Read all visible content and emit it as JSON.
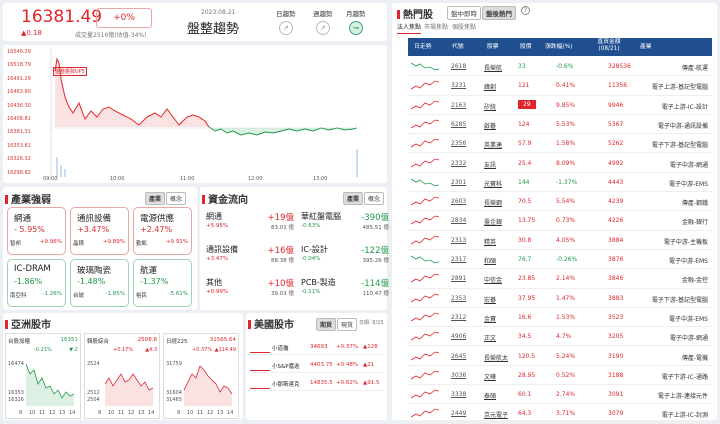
{
  "index": {
    "value": "16381.49",
    "change_pct": "+0%",
    "change": "▲0.18",
    "date": "2023.08.21",
    "volume": "成交量2516億(估值-34%)",
    "title": "盤整趨勢",
    "trend_buttons": [
      {
        "label": "日趨勢"
      },
      {
        "label": "週趨勢"
      },
      {
        "label": "月趨勢"
      }
    ],
    "y_ticks": [
      "16546.29",
      "16518.79",
      "16491.29",
      "16463.80",
      "16436.30",
      "16408.81",
      "16381.31",
      "16353.81",
      "16326.32",
      "16298.82"
    ],
    "x_ticks": [
      "09:00",
      "10:00",
      "11:00",
      "12:00",
      "13:00"
    ],
    "badge": "盤整趨勢UP5"
  },
  "industry": {
    "title": "產業強弱",
    "tabs": [
      "產業",
      "概念"
    ],
    "cards": [
      {
        "name": "網通",
        "pct": "- 5.95%",
        "sub1_label": "智邦",
        "sub1": "+9.96%",
        "color": "red"
      },
      {
        "name": "通訊設備",
        "pct": "+3.47%",
        "sub1_label": "晶鎂",
        "sub1": "+9.89%",
        "color": "red"
      },
      {
        "name": "電源供應",
        "pct": "+2.47%",
        "sub1_label": "勤凱",
        "sub1": "+9.91%",
        "color": "red"
      },
      {
        "name": "IC-DRAM",
        "pct": "-1.86%",
        "sub1_label": "南亞科",
        "sub1": "-1.26%",
        "color": "green"
      },
      {
        "name": "玻璃陶瓷",
        "pct": "-1.48%",
        "sub1_label": "台玻",
        "sub1": "-1.85%",
        "color": "green"
      },
      {
        "name": "航運",
        "pct": "-1.37%",
        "sub1_label": "裕民",
        "sub1": "-5.61%",
        "color": "green"
      }
    ]
  },
  "flows": {
    "title": "資金流向",
    "tabs": [
      "產業",
      "概念"
    ],
    "items": [
      {
        "name": "網通",
        "pct": "+5.95%",
        "value": "+19億",
        "sub": "83.01 億",
        "color": "red"
      },
      {
        "name": "通訊設備",
        "pct": "+3.47%",
        "value": "+16億",
        "sub": "88.38 億",
        "color": "red"
      },
      {
        "name": "其他",
        "pct": "+0.99%",
        "value": "+10億",
        "sub": "39.03 億",
        "color": "red"
      },
      {
        "name": "華紅盤電腦",
        "pct": "-0.63%",
        "value": "-390億",
        "sub": "485.51 億",
        "color": "green"
      },
      {
        "name": "IC-設計",
        "pct": "-0.04%",
        "value": "-122億",
        "sub": "395.26 億",
        "color": "green"
      },
      {
        "name": "PCB-製造",
        "pct": "-0.11%",
        "value": "-114億",
        "sub": "110.47 億",
        "color": "green"
      }
    ]
  },
  "asia": {
    "title": "亞洲股市",
    "charts": [
      {
        "name": "台股加權",
        "value": "16351",
        "pct": "-0.21%",
        "chg": "▼-2",
        "y1": "16474",
        "y2": "16353",
        "y3": "16326",
        "color": "green"
      },
      {
        "name": "韓股綜合",
        "value": "2508.8",
        "pct": "+0.17%",
        "chg": "▲4.3",
        "y1": "2524",
        "y2": "2512",
        "y3": "2504",
        "color": "red"
      },
      {
        "name": "日經225",
        "value": "31565.64",
        "pct": "+0.37%",
        "chg": "▲114.49",
        "y1": "31759",
        "y2": "31604",
        "y3": "31465",
        "color": "red"
      }
    ],
    "x_ticks": [
      "9",
      "10",
      "11",
      "12",
      "13",
      "14"
    ]
  },
  "us": {
    "title": "美國股市",
    "tabs": [
      "期貨",
      "現貨"
    ],
    "time": "日期: 8/25",
    "rows": [
      {
        "name": "小道瓊",
        "value": "34693",
        "pct": "+0.37%",
        "chg": "▲128"
      },
      {
        "name": "小S&P嘉逝",
        "value": "4403.75",
        "pct": "+0.48%",
        "chg": "▲21"
      },
      {
        "name": "小那斯達克",
        "value": "14835.5",
        "pct": "+0.62%",
        "chg": "▲91.5"
      }
    ]
  },
  "hot": {
    "title": "熱門股",
    "top_tabs": [
      "盤中即時",
      "盤後熱門"
    ],
    "sub_tabs": [
      "法人焦點",
      "市場焦點",
      "個股焦點"
    ],
    "headers": [
      "日走勢",
      "代號",
      "股票",
      "股價",
      "漲跌幅(%)",
      "直資金額\n(08/21)",
      "產業"
    ],
    "rows": [
      {
        "code": "2618",
        "name": "長榮航",
        "price": "33",
        "pct": "-0.6%",
        "amt": "328536",
        "ind": "傳產-航運",
        "up": false
      },
      {
        "code": "3231",
        "name": "緯創",
        "price": "121",
        "pct": "0.41%",
        "amt": "11356",
        "ind": "電子上游-基記型電腦",
        "up": true
      },
      {
        "code": "2163",
        "name": "矽統",
        "price": "29",
        "pct": "9.85%",
        "amt": "9946",
        "ind": "電子上游-IC-設計",
        "up": true,
        "hl": true
      },
      {
        "code": "6285",
        "name": "啟碁",
        "price": "124",
        "pct": "5.53%",
        "amt": "5367",
        "ind": "電子中游-通訊設備",
        "up": true
      },
      {
        "code": "2356",
        "name": "英業達",
        "price": "57.9",
        "pct": "1.58%",
        "amt": "5262",
        "ind": "電子下游-基記型電腦",
        "up": true
      },
      {
        "code": "2332",
        "name": "友訊",
        "price": "25.4",
        "pct": "8.09%",
        "amt": "4992",
        "ind": "電子中游-網通",
        "up": true
      },
      {
        "code": "2301",
        "name": "光寶科",
        "price": "144",
        "pct": "-1.37%",
        "amt": "4443",
        "ind": "電子中游-EMS",
        "up": false
      },
      {
        "code": "2603",
        "name": "長榮鋼",
        "price": "70.5",
        "pct": "5.54%",
        "amt": "4239",
        "ind": "傳產-鋼鐵",
        "up": true
      },
      {
        "code": "2834",
        "name": "臺企銀",
        "price": "13.75",
        "pct": "0.73%",
        "amt": "4226",
        "ind": "金融-銀行",
        "up": true
      },
      {
        "code": "2313",
        "name": "精英",
        "price": "30.8",
        "pct": "4.05%",
        "amt": "3884",
        "ind": "電子中游-主機板",
        "up": true
      },
      {
        "code": "2317",
        "name": "和碩",
        "price": "76.7",
        "pct": "-0.26%",
        "amt": "3876",
        "ind": "電子中游-EMS",
        "up": false
      },
      {
        "code": "2891",
        "name": "中信金",
        "price": "23.85",
        "pct": "2.14%",
        "amt": "3846",
        "ind": "金融-金控",
        "up": true
      },
      {
        "code": "2353",
        "name": "宏碁",
        "price": "37.95",
        "pct": "1.47%",
        "amt": "3883",
        "ind": "電子下游-基記型電腦",
        "up": true
      },
      {
        "code": "2312",
        "name": "金寶",
        "price": "16.6",
        "pct": "1.53%",
        "amt": "3523",
        "ind": "電子中游-EMS",
        "up": true
      },
      {
        "code": "4906",
        "name": "正文",
        "price": "34.5",
        "pct": "4.7%",
        "amt": "3205",
        "ind": "電子中游-網通",
        "up": true
      },
      {
        "code": "2645",
        "name": "長榮航太",
        "price": "120.5",
        "pct": "5.24%",
        "amt": "3190",
        "ind": "傳產-電機",
        "up": true
      },
      {
        "code": "3036",
        "name": "文曄",
        "price": "28.95",
        "pct": "0.52%",
        "amt": "3188",
        "ind": "電子下游-IC-通路",
        "up": true
      },
      {
        "code": "3338",
        "name": "泰碩",
        "price": "60.1",
        "pct": "2.74%",
        "amt": "3091",
        "ind": "電子上游-連接元件",
        "up": true
      },
      {
        "code": "2449",
        "name": "京元電子",
        "price": "64.3",
        "pct": "3.71%",
        "amt": "3079",
        "ind": "電子上游-IC-封測",
        "up": true
      }
    ]
  }
}
